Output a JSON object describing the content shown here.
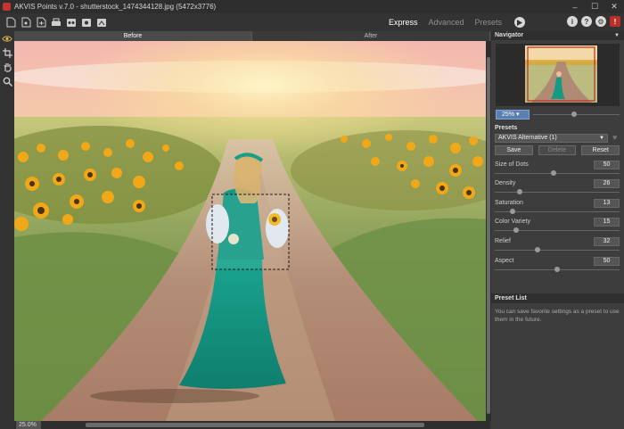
{
  "window": {
    "title": "AKVIS Points v.7.0 - shutterstock_1474344128.jpg (5472x3776)",
    "minimize": "–",
    "maximize": "☐",
    "close": "✕"
  },
  "toolbar": {
    "modes": [
      "Express",
      "Advanced",
      "Presets"
    ],
    "active_mode": "Express",
    "right_icons": [
      "i",
      "?",
      "⚙",
      "!"
    ]
  },
  "view_tabs": [
    "Before",
    "After"
  ],
  "canvas": {
    "zoom_label": "25.0%"
  },
  "navigator": {
    "title": "Navigator",
    "zoom_value": "25%",
    "zoom_level": 0.47
  },
  "presets": {
    "label": "Presets",
    "selected": "AKVIS Alternative (1)",
    "save": "Save",
    "delete": "Delete",
    "reset": "Reset"
  },
  "params": [
    {
      "label": "Size of Dots",
      "value": "50",
      "level": 0.47
    },
    {
      "label": "Density",
      "value": "26",
      "level": 0.2
    },
    {
      "label": "Saturation",
      "value": "13",
      "level": 0.14
    },
    {
      "label": "Color Variety",
      "value": "15",
      "level": 0.17
    },
    {
      "label": "Relief",
      "value": "32",
      "level": 0.34
    },
    {
      "label": "Aspect",
      "value": "50",
      "level": 0.5
    }
  ],
  "preset_list": {
    "title": "Preset List",
    "text": "You can save favorite settings as a preset to use them in the future."
  },
  "colors": {
    "accent": "#5a7fb0",
    "panel": "#3d3d3d",
    "brand": "#c8332f"
  }
}
